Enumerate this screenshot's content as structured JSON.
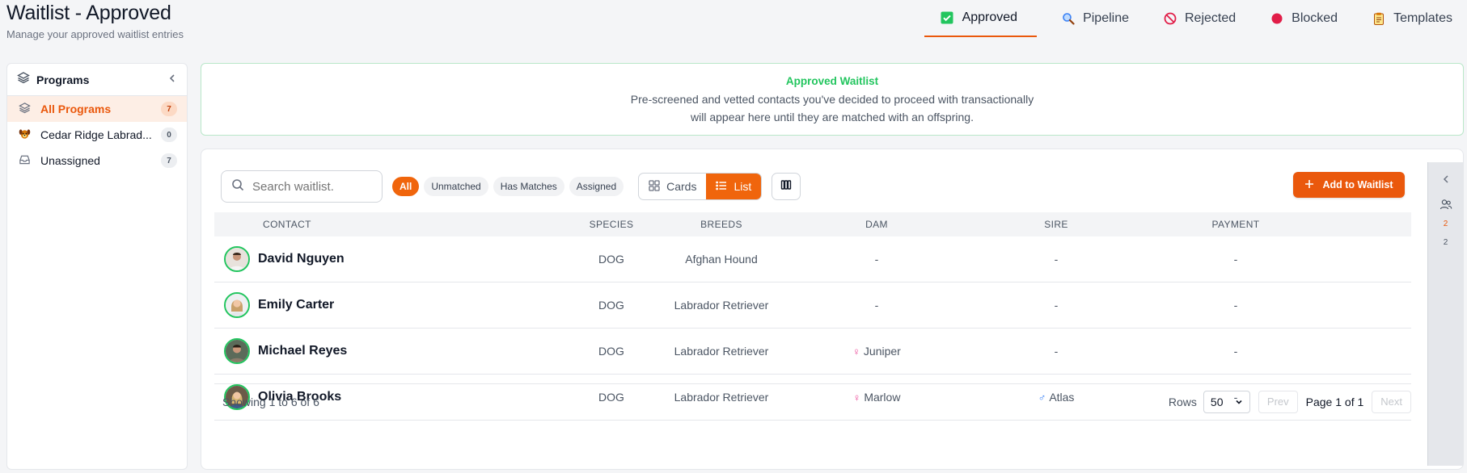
{
  "header": {
    "title": "Waitlist - Approved",
    "subtitle": "Manage your approved waitlist entries"
  },
  "tabs": [
    {
      "label": "Approved",
      "icon": "check-square-icon",
      "active": true
    },
    {
      "label": "Pipeline",
      "icon": "magnifier-icon"
    },
    {
      "label": "Rejected",
      "icon": "no-entry-icon"
    },
    {
      "label": "Blocked",
      "icon": "red-circle-icon"
    },
    {
      "label": "Templates",
      "icon": "clipboard-icon"
    }
  ],
  "sidebar": {
    "title": "Programs",
    "items": [
      {
        "label": "All Programs",
        "count": "7",
        "icon": "layers-icon",
        "active": true
      },
      {
        "label": "Cedar Ridge Labrad...",
        "count": "0",
        "icon": "dog-icon"
      },
      {
        "label": "Unassigned",
        "count": "7",
        "icon": "inbox-icon"
      }
    ]
  },
  "banner": {
    "title": "Approved Waitlist",
    "line1": "Pre-screened and vetted contacts you've decided to proceed with transactionally",
    "line2": "will appear here until they are matched with an offspring."
  },
  "toolbar": {
    "search_placeholder": "Search waitlist.",
    "filters": [
      "All",
      "Unmatched",
      "Has Matches",
      "Assigned"
    ],
    "view_cards": "Cards",
    "view_list": "List",
    "add_label": "Add to Waitlist"
  },
  "table": {
    "headers": {
      "contact": "CONTACT",
      "species": "SPECIES",
      "breeds": "BREEDS",
      "dam": "DAM",
      "sire": "SIRE",
      "payment": "PAYMENT"
    },
    "rows": [
      {
        "name": "David Nguyen",
        "species": "DOG",
        "breed": "Afghan Hound",
        "dam": "-",
        "sire": "-",
        "payment": "-"
      },
      {
        "name": "Emily Carter",
        "species": "DOG",
        "breed": "Labrador Retriever",
        "dam": "-",
        "sire": "-",
        "payment": "-"
      },
      {
        "name": "Michael Reyes",
        "species": "DOG",
        "breed": "Labrador Retriever",
        "dam": "Juniper",
        "sire": "-",
        "payment": "-"
      },
      {
        "name": "Olivia Brooks",
        "species": "DOG",
        "breed": "Labrador Retriever",
        "dam": "Marlow",
        "sire": "Atlas",
        "payment": "-"
      }
    ]
  },
  "footer": {
    "showing": "Showing 1 to 6 of 6",
    "rows_label": "Rows",
    "rows_value": "50",
    "prev": "Prev",
    "page_info": "Page 1 of 1",
    "next": "Next"
  },
  "rail": {
    "count_a": "2",
    "count_b": "2"
  },
  "colors": {
    "accent": "#ea580c",
    "success": "#22c55e"
  }
}
